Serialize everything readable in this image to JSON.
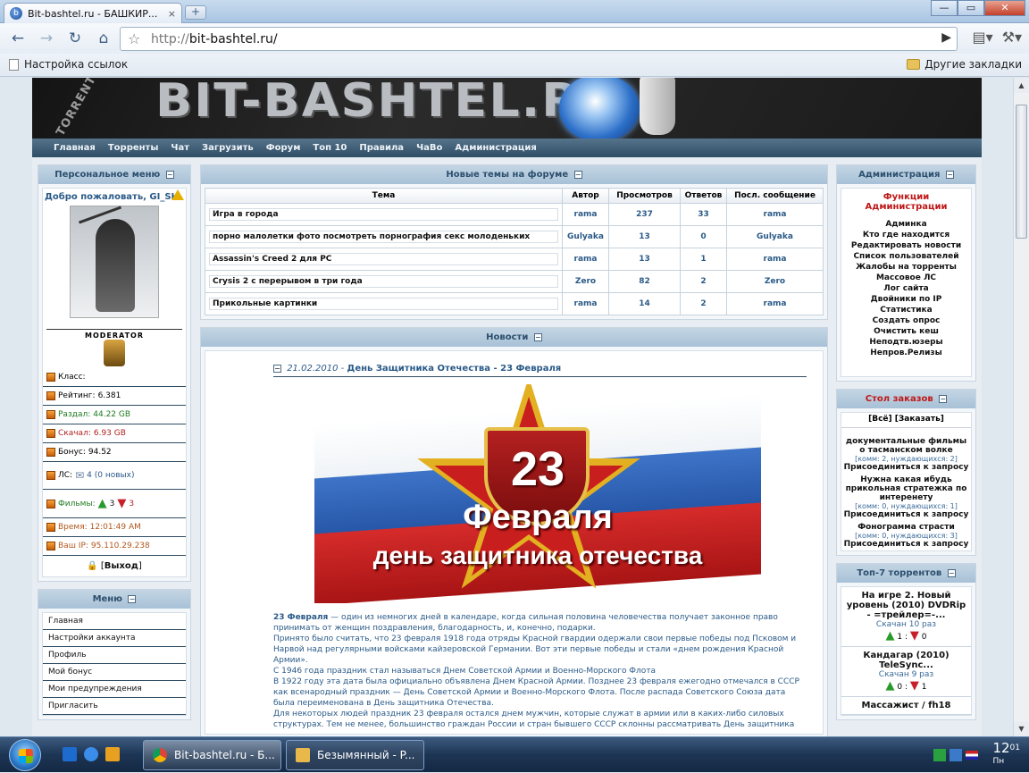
{
  "browser": {
    "tab_title": "Bit-bashtel.ru - БАШКИР...",
    "tab_close": "×",
    "new_tab": "+",
    "url_scheme": "http://",
    "url_host": "bit-bashtel.ru/",
    "bookmark_left": "Настройка ссылок",
    "bookmark_right": "Другие закладки",
    "win_min": "—",
    "win_max": "▭",
    "win_close": "✕"
  },
  "site": {
    "nav": [
      "Главная",
      "Торренты",
      "Чат",
      "Загрузить",
      "Форум",
      "Топ 10",
      "Правила",
      "ЧаВо",
      "Администрация"
    ],
    "personal_menu": {
      "title": "Персональное меню",
      "welcome": "Добро пожаловать, GI_SH",
      "rank": "MODERATOR",
      "class_label": "Класс:",
      "rating_label": "Рейтинг:",
      "rating": "6.381",
      "upload_label": "Раздал:",
      "upload": "44.22 GB",
      "download_label": "Скачал:",
      "download": "6.93 GB",
      "bonus_label": "Бонус:",
      "bonus": "94.52",
      "pm_label": "ЛС:",
      "pm": "4 (0 новых)",
      "films_label": "Фильмы:",
      "films_up": "3",
      "films_down": "3",
      "time_label": "Время:",
      "time": "12:01:49 AM",
      "ip_label": "Ваш IP:",
      "ip": "95.110.29.238",
      "logout": "Выход"
    },
    "menu": {
      "title": "Меню",
      "items": [
        "Главная",
        "Настройки аккаунта",
        "Профиль",
        "Мой бонус",
        "Мои предупреждения",
        "Пригласить"
      ]
    },
    "forum": {
      "title": "Новые темы на форуме",
      "columns": [
        "Тема",
        "Автор",
        "Просмотров",
        "Ответов",
        "Посл. сообщение"
      ],
      "rows": [
        [
          "Игра в города",
          "rama",
          "237",
          "33",
          "rama"
        ],
        [
          "порно малолетки фото посмотреть порнография секс молоденьких",
          "Gulyaka",
          "13",
          "0",
          "Gulyaka"
        ],
        [
          "Assassin's Creed 2 для PC",
          "rama",
          "13",
          "1",
          "rama"
        ],
        [
          "Crysis 2 с перерывом в три года",
          "Zero",
          "82",
          "2",
          "Zero"
        ],
        [
          "Прикольные картинки",
          "rama",
          "14",
          "2",
          "rama"
        ]
      ]
    },
    "news": {
      "title": "Новости",
      "date": "21.02.2010",
      "sep": " - ",
      "headline": "День Защитника Отечества - 23 Февраля",
      "poster_number": "23",
      "poster_month": "Февраля",
      "poster_sub": "день защитника отечества",
      "lead_bold": "23 Февраля",
      "paragraphs": [
        " — один из немногих дней в календаре, когда сильная половина человечества получает законное право принимать от женщин поздравления, благодарность, и, конечно, подарки.",
        "Принято было считать, что 23 февраля 1918 года отряды Красной гвардии одержали свои первые победы под Псковом и Нарвой над регулярными войсками кайзеровской Германии. Вот эти первые победы и стали «днем рождения Красной Армии».",
        "С 1946 года праздник стал называться Днем Советской Армии и Военно-Морского Флота",
        "В 1922 году эта дата была официально объявлена Днем Красной Армии. Позднее 23 февраля ежегодно отмечался в СССР как всенародный праздник — День Советской Армии и Военно-Морского Флота. После распада Советского Союза дата была переименована в День защитника Отечества.",
        "Для некоторых людей праздник 23 февраля остался днем мужчин, которые служат в армии или в каких-либо силовых структурах. Тем не менее, большинство граждан России и стран бывшего СССР склонны рассматривать День защитника"
      ]
    },
    "admin": {
      "title": "Администрация",
      "subtitle": "Функции Администрации",
      "items": [
        "Админка",
        "Кто где находится",
        "Редактировать новости",
        "Список пользователей",
        "Жалобы на торренты",
        "Массовое ЛС",
        "Лог сайта",
        "Двойники по IP",
        "Статистика",
        "Создать опрос",
        "Очистить кеш",
        "Неподтв.юзеры",
        "Непров.Релизы"
      ]
    },
    "orders": {
      "title": "Стол заказов",
      "link_all": "[Всё]",
      "link_order": "[Заказать]",
      "items": [
        {
          "name": "документальные фильмы о тасманском волке",
          "comments": "[комм: 2, нуждающихся: 2]",
          "join": "Присоединиться к запросу"
        },
        {
          "name": "Нужна какая ибудь прикольная стратежка по интеренету",
          "comments": "[комм: 0, нуждающихся: 1]",
          "join": "Присоединиться к запросу"
        },
        {
          "name": "Фонограмма страсти",
          "comments": "[комм: 0, нуждающихся: 3]",
          "join": "Присоединиться к запросу"
        }
      ]
    },
    "top7": {
      "title": "Топ-7 торрентов",
      "items": [
        {
          "name": "На игре 2. Новый уровень (2010) DVDRip - =трейлер=-...",
          "downloads": "Скачан 10 раз",
          "up": "1",
          "down": "0"
        },
        {
          "name": "Кандагар (2010) TeleSync...",
          "downloads": "Скачан 9 раз",
          "up": "0",
          "down": "1"
        },
        {
          "name": "Массажист / fh18",
          "downloads": "",
          "up": "",
          "down": ""
        }
      ]
    }
  },
  "taskbar": {
    "tasks": [
      "Bit-bashtel.ru - Б...",
      "Безымянный - P..."
    ],
    "clock": "12",
    "clock_min": "01",
    "clock_day": "Пн"
  },
  "colors": {
    "accent": "#2a5a88",
    "nav_bg": "#2f4d65",
    "admin_red": "#c01818"
  }
}
